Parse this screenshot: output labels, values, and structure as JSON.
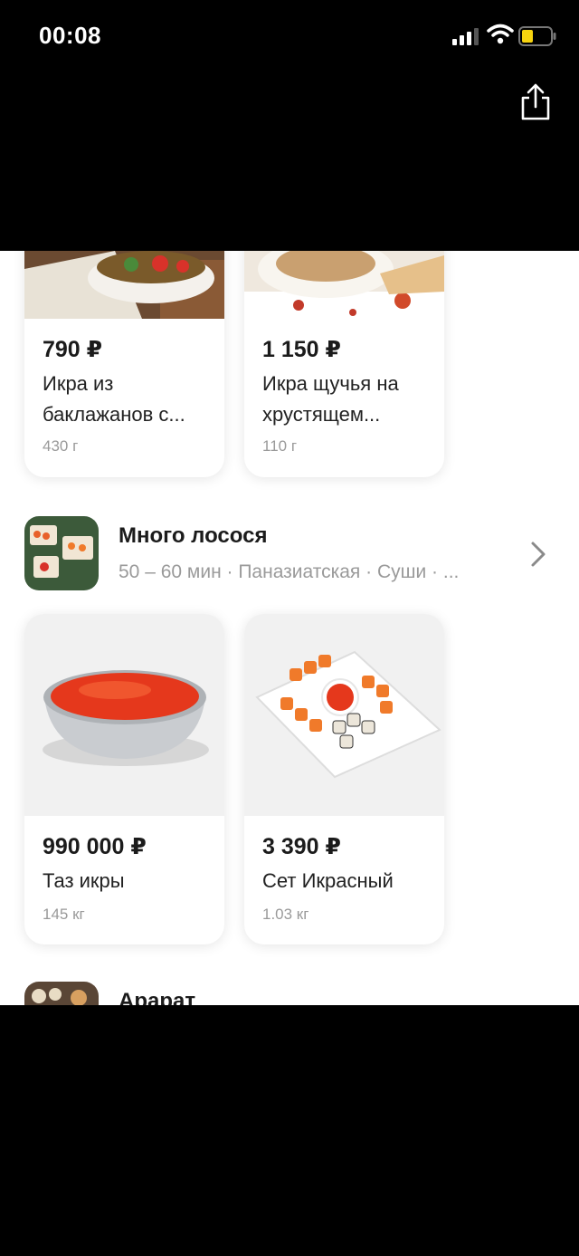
{
  "status_bar": {
    "time": "00:08"
  },
  "cards_top": [
    {
      "price": "790 ₽",
      "name": "Икра из баклажанов с...",
      "weight": "430 г"
    },
    {
      "price": "1 150 ₽",
      "name": "Икра щучья на хрустящем...",
      "weight": "110 г"
    }
  ],
  "store": {
    "name": "Много лосося",
    "meta": "50 – 60 мин · Паназиатская · Суши · ..."
  },
  "cards_bottom": [
    {
      "price": "990 000 ₽",
      "name": "Таз икры",
      "weight": "145 кг"
    },
    {
      "price": "3 390 ₽",
      "name": "Сет Икрасный",
      "weight": "1.03 кг"
    }
  ],
  "next_store": {
    "name": "Арарат"
  }
}
